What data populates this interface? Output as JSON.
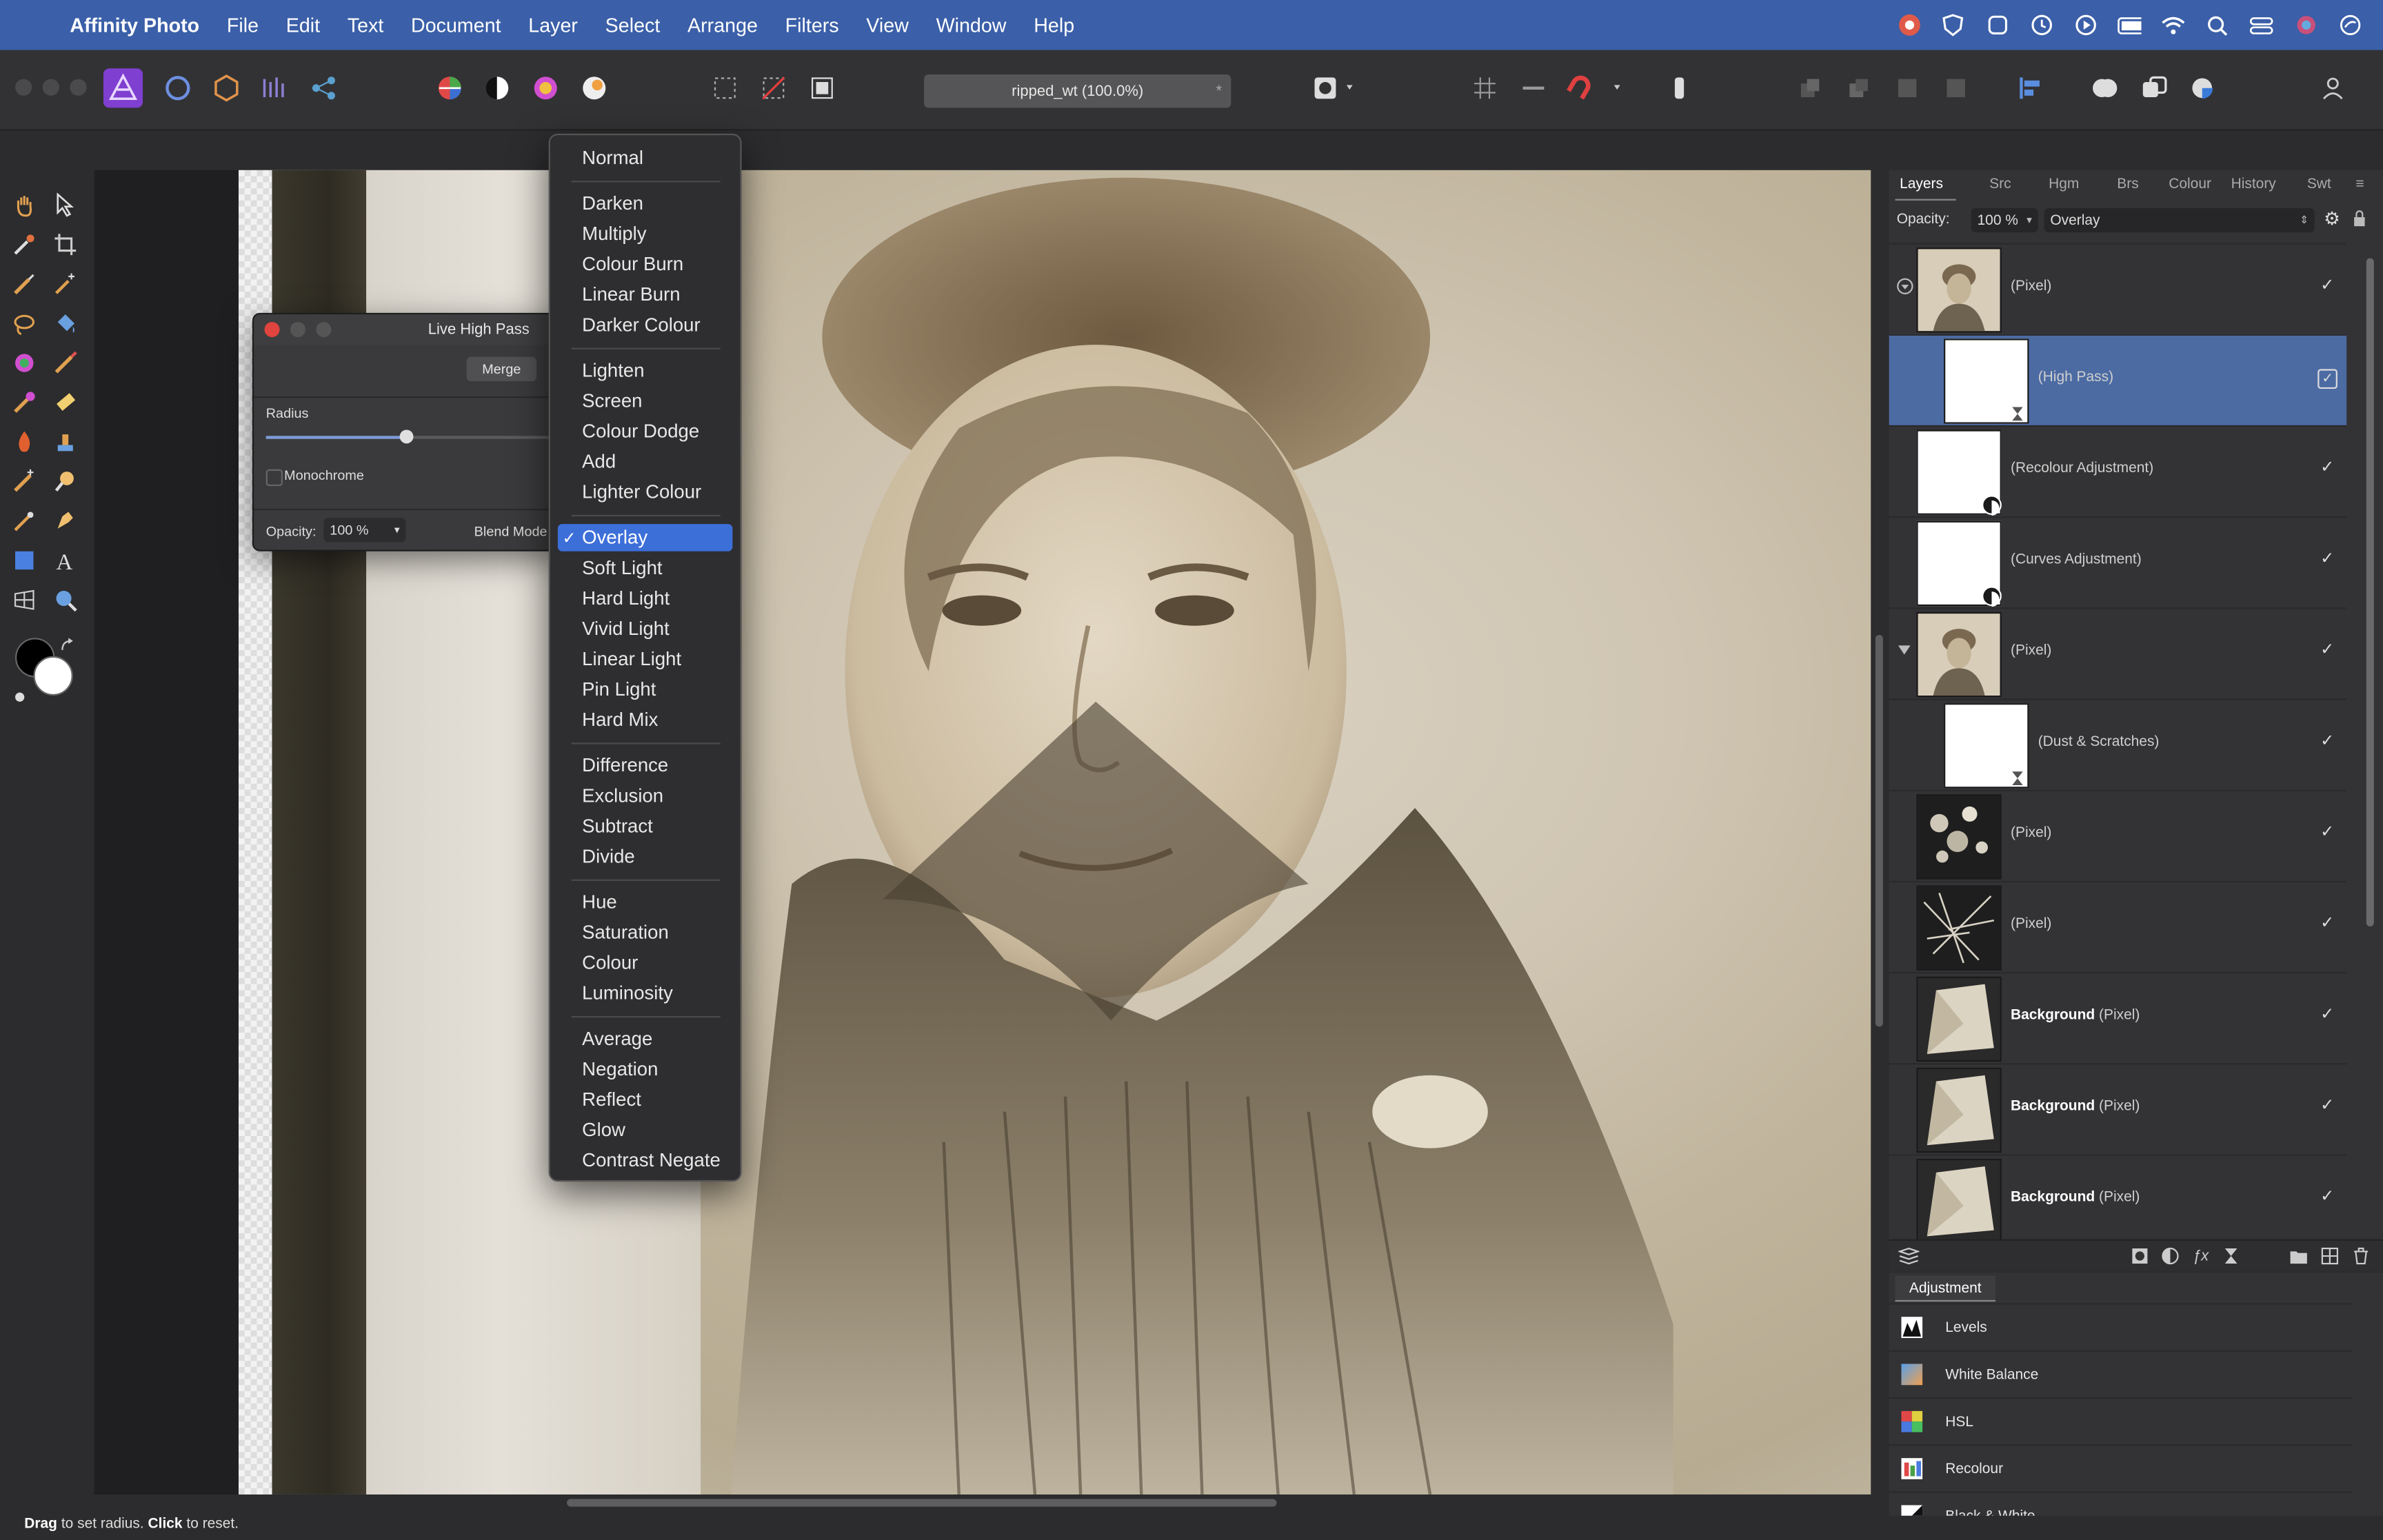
{
  "menubar": {
    "app": "Affinity Photo",
    "items": [
      "File",
      "Edit",
      "Text",
      "Document",
      "Layer",
      "Select",
      "Arrange",
      "Filters",
      "View",
      "Window",
      "Help"
    ]
  },
  "document": {
    "title": "ripped_wt (100.0%)"
  },
  "high_pass": {
    "title": "Live High Pass",
    "merge_label": "Merge",
    "radius_label": "Radius",
    "radius_value_fraction": 0.48,
    "monochrome_label": "Monochrome",
    "opacity_label": "Opacity:",
    "opacity_value": "100 %",
    "blend_label": "Blend Mode"
  },
  "blend_menu": {
    "selected": "Overlay",
    "groups": [
      [
        "Normal"
      ],
      [
        "Darken",
        "Multiply",
        "Colour Burn",
        "Linear Burn",
        "Darker Colour"
      ],
      [
        "Lighten",
        "Screen",
        "Colour Dodge",
        "Add",
        "Lighter Colour"
      ],
      [
        "Overlay",
        "Soft Light",
        "Hard Light",
        "Vivid Light",
        "Linear Light",
        "Pin Light",
        "Hard Mix"
      ],
      [
        "Difference",
        "Exclusion",
        "Subtract",
        "Divide"
      ],
      [
        "Hue",
        "Saturation",
        "Colour",
        "Luminosity"
      ],
      [
        "Average",
        "Negation",
        "Reflect",
        "Glow",
        "Contrast Negate"
      ]
    ]
  },
  "layers_panel": {
    "tabs": [
      "Layers",
      "Src",
      "Hgm",
      "Brs",
      "Colour",
      "History",
      "Swt"
    ],
    "opacity_label": "Opacity:",
    "opacity_value": "100 %",
    "blend_value": "Overlay",
    "layers": [
      {
        "bold": "",
        "name": "(Pixel)",
        "indent": 0,
        "expander": "circle",
        "thumb": "portrait",
        "selected": false
      },
      {
        "bold": "",
        "name": "(High Pass)",
        "indent": 1,
        "expander": "",
        "thumb": "white-filter",
        "selected": true
      },
      {
        "bold": "",
        "name": "(Recolour Adjustment)",
        "indent": 0,
        "expander": "",
        "thumb": "white-adjust",
        "selected": false
      },
      {
        "bold": "",
        "name": "(Curves Adjustment)",
        "indent": 0,
        "expander": "",
        "thumb": "white-adjust",
        "selected": false
      },
      {
        "bold": "",
        "name": "(Pixel)",
        "indent": 0,
        "expander": "triangle",
        "thumb": "portrait",
        "selected": false
      },
      {
        "bold": "",
        "name": "(Dust & Scratches)",
        "indent": 1,
        "expander": "",
        "thumb": "white-filter",
        "selected": false
      },
      {
        "bold": "",
        "name": "(Pixel)",
        "indent": 0,
        "expander": "",
        "thumb": "spots",
        "selected": false
      },
      {
        "bold": "",
        "name": "(Pixel)",
        "indent": 0,
        "expander": "",
        "thumb": "scratches",
        "selected": false
      },
      {
        "bold": "Background",
        "name": "(Pixel)",
        "indent": 0,
        "expander": "",
        "thumb": "paper",
        "selected": false
      },
      {
        "bold": "Background",
        "name": "(Pixel)",
        "indent": 0,
        "expander": "",
        "thumb": "paper",
        "selected": false
      },
      {
        "bold": "Background",
        "name": "(Pixel)",
        "indent": 0,
        "expander": "",
        "thumb": "paper",
        "selected": false
      }
    ]
  },
  "adjustment_panel": {
    "tab": "Adjustment",
    "items": [
      "Levels",
      "White Balance",
      "HSL",
      "Recolour",
      "Black & White"
    ]
  },
  "status": {
    "drag": "Drag",
    "drag_text": " to set radius. ",
    "click": "Click",
    "click_text": " to reset."
  },
  "colors": {
    "menubar": "#3b5fa8",
    "selection": "#3d6fd9",
    "selected_layer": "#4c6ba3",
    "panel": "#333335"
  }
}
